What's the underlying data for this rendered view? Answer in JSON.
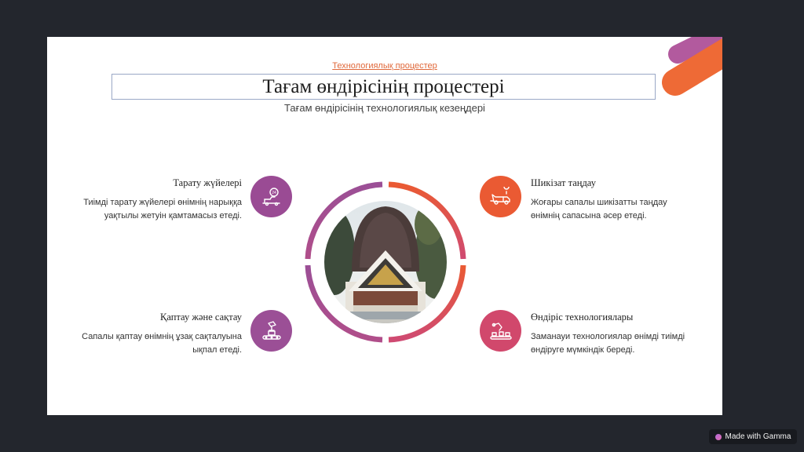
{
  "slide": {
    "eyebrow": "Технологиялық процестер",
    "title": "Тағам өндірісінің процестері",
    "subtitle": "Тағам өндірісінің технологиялық кезеңдері"
  },
  "stages": [
    {
      "id": "distribution",
      "heading": "Тарату жүйелері",
      "line1": "Тиімді тарату жүйелері өнімнің нарыққа",
      "line2": "уақтылы жетуін қамтамасыз етеді.",
      "icon": "delivery-24h-icon",
      "color": "#9a4b94"
    },
    {
      "id": "raw",
      "heading": "Шикізат таңдау",
      "line1": "Жоғары сапалы шикізатты таңдау",
      "line2": "өнімнің сапасына әсер етеді.",
      "icon": "delivery-truck-icon",
      "color": "#ea5a33"
    },
    {
      "id": "packaging",
      "heading": "Қаптау және сақтау",
      "line1": "Сапалы қаптау өнімнің ұзақ сақталуына",
      "line2": "ықпал етеді.",
      "icon": "conveyor-box-icon",
      "color": "#9b4f96"
    },
    {
      "id": "production",
      "heading": "Өндіріс технологиялары",
      "line1": "Заманауи технологиялар өнімді тиімді",
      "line2": "өндіруге мүмкіндік береді.",
      "icon": "robot-arm-factory-icon",
      "color": "#d1486c"
    }
  ],
  "colors": {
    "accent_orange": "#ea5a33",
    "accent_purple": "#9a4b94",
    "accent_pink": "#d1486c"
  },
  "badge": {
    "label": "Made with Gamma"
  }
}
